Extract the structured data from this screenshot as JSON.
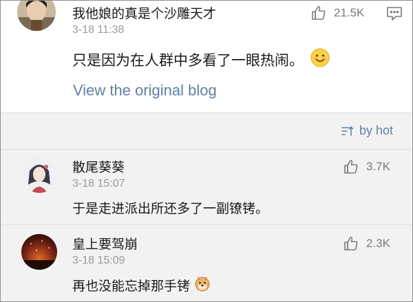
{
  "main_post": {
    "username": "我他娘的真是个沙雕天才",
    "timestamp": "3-18 11:38",
    "like_count": "21.5K",
    "text": "只是因为在人群中多看了一眼热闹。",
    "emoji": "smile-emoji",
    "view_link": "View the original blog"
  },
  "sort": {
    "label": "by hot",
    "icon": "sort-icon"
  },
  "comments": [
    {
      "username": "散尾葵葵",
      "timestamp": "3-18 15:07",
      "like_count": "3.7K",
      "text": "于是走进派出所还多了一副镣铐。"
    },
    {
      "username": "皇上要驾崩",
      "timestamp": "3-18 15:09",
      "like_count": "2.3K",
      "text": "再也没能忘掉那手铐",
      "emoji": "doge-emoji"
    }
  ],
  "colors": {
    "link": "#5e7fa9",
    "secondary_text": "#9a9a9a",
    "background": "#f2f2f2"
  }
}
